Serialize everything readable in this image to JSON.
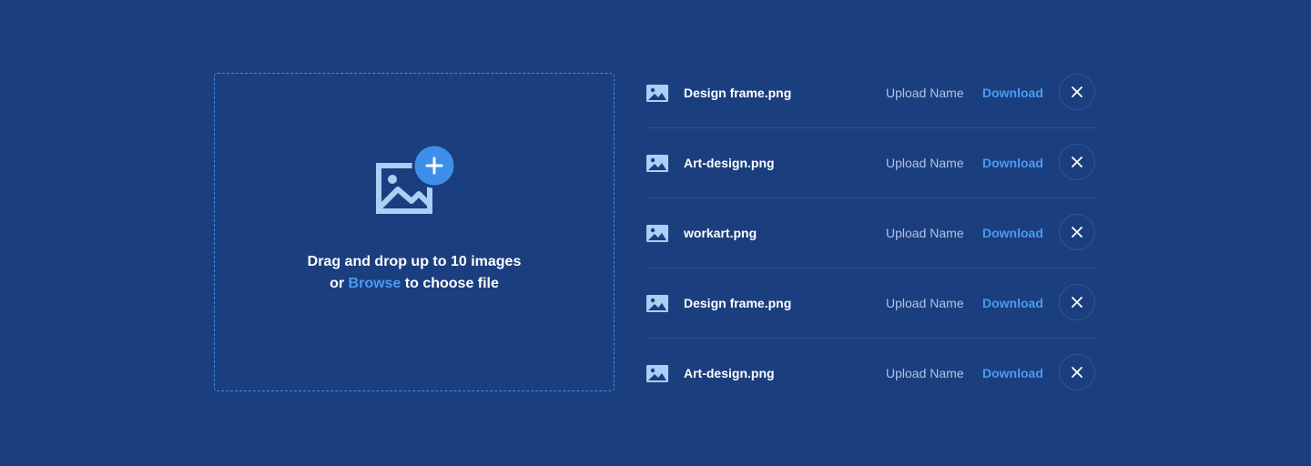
{
  "dropzone": {
    "line1": "Drag and drop up to 10 images",
    "line2_prefix": "or ",
    "browse_label": "Browse",
    "line2_suffix": " to choose file",
    "icon": "add-image-icon"
  },
  "files": [
    {
      "name": "Design frame.png",
      "upload_name": "Upload Name",
      "download_label": "Download"
    },
    {
      "name": "Art-design.png",
      "upload_name": "Upload Name",
      "download_label": "Download"
    },
    {
      "name": "workart.png",
      "upload_name": "Upload Name",
      "download_label": "Download"
    },
    {
      "name": "Design frame.png",
      "upload_name": "Upload Name",
      "download_label": "Download"
    },
    {
      "name": "Art-design.png",
      "upload_name": "Upload Name",
      "download_label": "Download"
    }
  ],
  "colors": {
    "background": "#1B3E7E",
    "accent": "#4A9BF5",
    "icon_light": "#A9D1F7",
    "divider": "#2A5296",
    "muted_text": "#AFC3E5"
  }
}
